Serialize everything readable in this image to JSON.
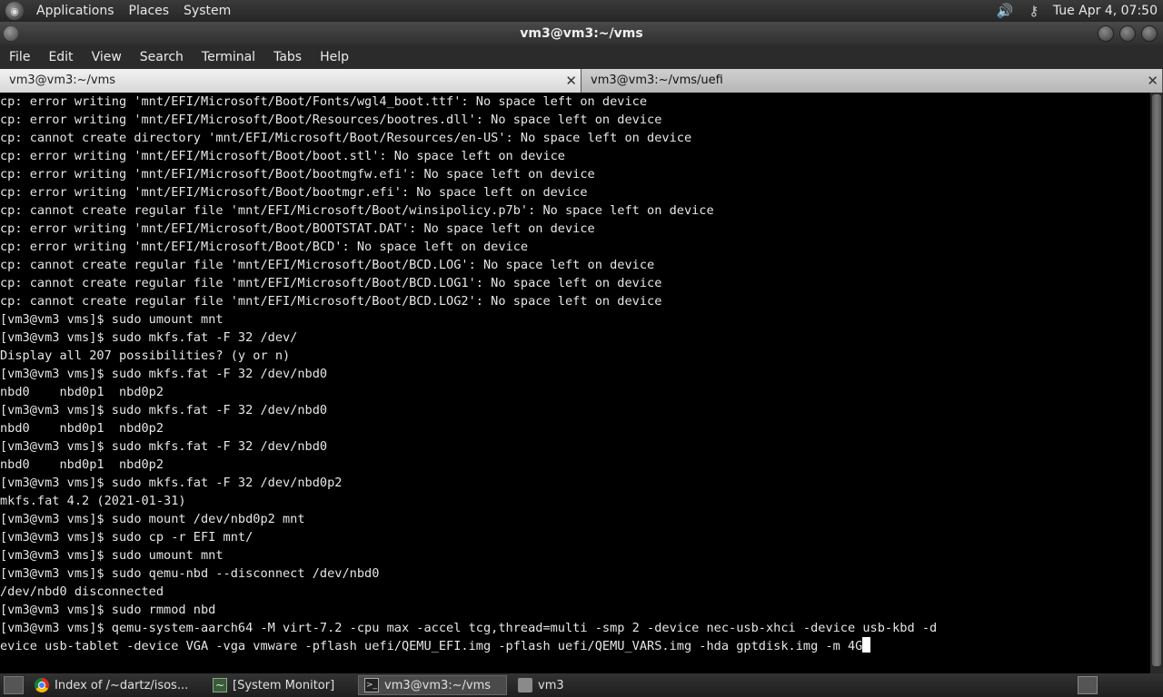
{
  "top_panel": {
    "menus": [
      "Applications",
      "Places",
      "System"
    ],
    "clock": "Tue Apr  4, 07:50"
  },
  "window": {
    "title": "vm3@vm3:~/vms"
  },
  "menubar": [
    "File",
    "Edit",
    "View",
    "Search",
    "Terminal",
    "Tabs",
    "Help"
  ],
  "tabs": [
    {
      "label": "vm3@vm3:~/vms",
      "close": "✕"
    },
    {
      "label": "vm3@vm3:~/vms/uefi",
      "close": "✕"
    }
  ],
  "terminal_lines": [
    "cp: error writing 'mnt/EFI/Microsoft/Boot/Fonts/wgl4_boot.ttf': No space left on device",
    "cp: error writing 'mnt/EFI/Microsoft/Boot/Resources/bootres.dll': No space left on device",
    "cp: cannot create directory 'mnt/EFI/Microsoft/Boot/Resources/en-US': No space left on device",
    "cp: error writing 'mnt/EFI/Microsoft/Boot/boot.stl': No space left on device",
    "cp: error writing 'mnt/EFI/Microsoft/Boot/bootmgfw.efi': No space left on device",
    "cp: error writing 'mnt/EFI/Microsoft/Boot/bootmgr.efi': No space left on device",
    "cp: cannot create regular file 'mnt/EFI/Microsoft/Boot/winsipolicy.p7b': No space left on device",
    "cp: error writing 'mnt/EFI/Microsoft/Boot/BOOTSTAT.DAT': No space left on device",
    "cp: error writing 'mnt/EFI/Microsoft/Boot/BCD': No space left on device",
    "cp: cannot create regular file 'mnt/EFI/Microsoft/Boot/BCD.LOG': No space left on device",
    "cp: cannot create regular file 'mnt/EFI/Microsoft/Boot/BCD.LOG1': No space left on device",
    "cp: cannot create regular file 'mnt/EFI/Microsoft/Boot/BCD.LOG2': No space left on device",
    "[vm3@vm3 vms]$ sudo umount mnt",
    "[vm3@vm3 vms]$ sudo mkfs.fat -F 32 /dev/",
    "Display all 207 possibilities? (y or n)",
    "[vm3@vm3 vms]$ sudo mkfs.fat -F 32 /dev/nbd0",
    "nbd0    nbd0p1  nbd0p2",
    "[vm3@vm3 vms]$ sudo mkfs.fat -F 32 /dev/nbd0",
    "nbd0    nbd0p1  nbd0p2",
    "[vm3@vm3 vms]$ sudo mkfs.fat -F 32 /dev/nbd0",
    "nbd0    nbd0p1  nbd0p2",
    "[vm3@vm3 vms]$ sudo mkfs.fat -F 32 /dev/nbd0p2",
    "mkfs.fat 4.2 (2021-01-31)",
    "[vm3@vm3 vms]$ sudo mount /dev/nbd0p2 mnt",
    "[vm3@vm3 vms]$ sudo cp -r EFI mnt/",
    "[vm3@vm3 vms]$ sudo umount mnt",
    "[vm3@vm3 vms]$ sudo qemu-nbd --disconnect /dev/nbd0",
    "/dev/nbd0 disconnected",
    "[vm3@vm3 vms]$ sudo rmmod nbd",
    "[vm3@vm3 vms]$ qemu-system-aarch64 -M virt-7.2 -cpu max -accel tcg,thread=multi -smp 2 -device nec-usb-xhci -device usb-kbd -d",
    "evice usb-tablet -device VGA -vga vmware -pflash uefi/QEMU_EFI.img -pflash uefi/QEMU_VARS.img -hda gptdisk.img -m 4G"
  ],
  "taskbar": {
    "tasks": [
      {
        "label": "Index of /~dartz/isos...",
        "icon": "chrome-icon"
      },
      {
        "label": "[System Monitor]",
        "icon": "monitor-icon"
      },
      {
        "label": "vm3@vm3:~/vms",
        "icon": "terminal-icon"
      },
      {
        "label": "vm3",
        "icon": "folder-icon"
      }
    ]
  }
}
